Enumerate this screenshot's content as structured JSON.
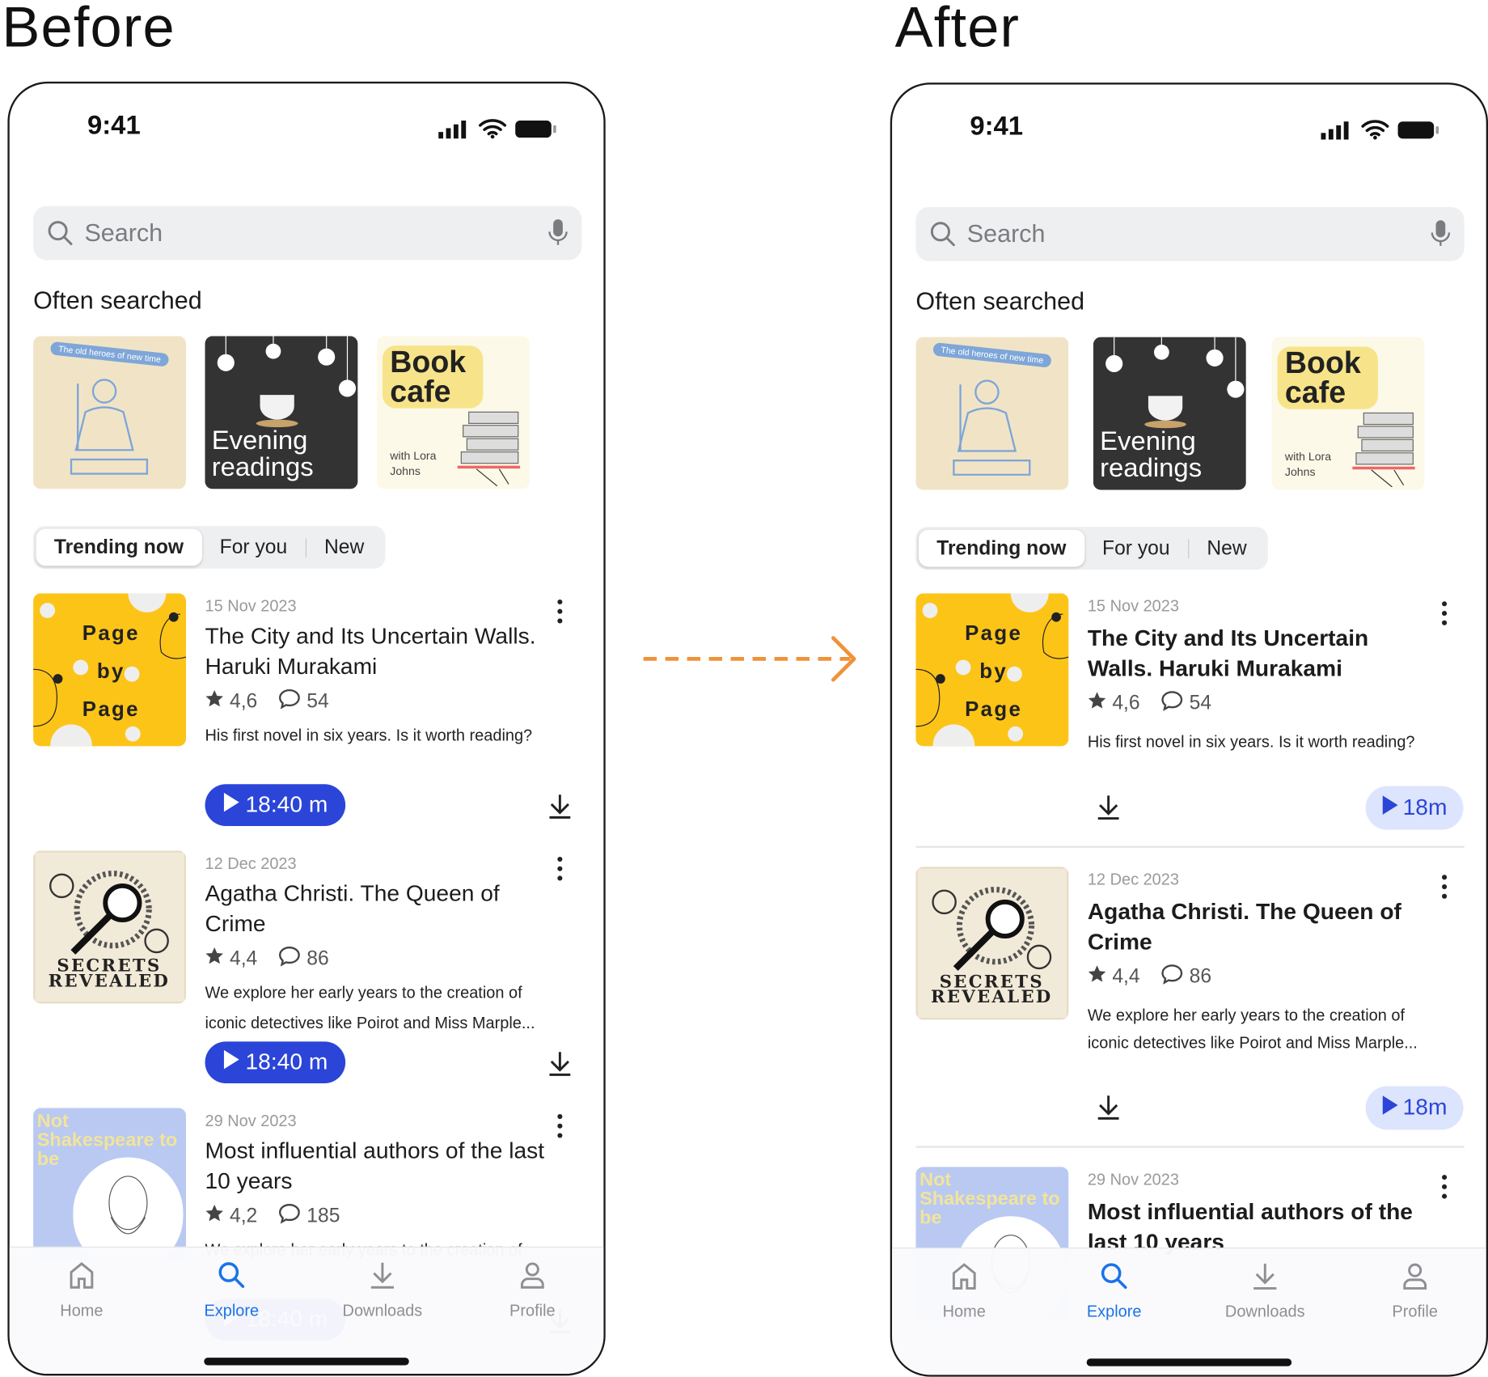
{
  "labels": {
    "before": "Before",
    "after": "After"
  },
  "colors": {
    "accent": "#2b45d8",
    "accent_soft": "#dde4fd",
    "arrow": "#f0923a",
    "nav_active": "#1a73e8"
  },
  "phones": {
    "before": {
      "status_time": "9:41",
      "search_placeholder": "Search",
      "section_title": "Often searched",
      "often_searched": [
        {
          "art_text": "The old heroes of new time"
        },
        {
          "art_text": "Evening readings"
        },
        {
          "art_text": "Book cafe",
          "art_subtext": "with Lora Johns"
        }
      ],
      "tabs": [
        {
          "label": "Trending now",
          "active": true
        },
        {
          "label": "For you"
        },
        {
          "label": "New"
        }
      ],
      "cards": [
        {
          "date": "15 Nov 2023",
          "title": "The City and Its Uncertain Walls. Haruki Murakami",
          "rating": "4,6",
          "comments": "54",
          "description": "His first novel in six years. Is it worth reading?",
          "duration": "18:40 m",
          "art_text": "Page by Page"
        },
        {
          "date": "12 Dec 2023",
          "title": "Agatha Christi. The Queen of Crime",
          "rating": "4,4",
          "comments": "86",
          "description": "We explore her early years to the creation of iconic detectives like Poirot and Miss Marple...",
          "duration": "18:40 m",
          "art_text": "SECRETS REVEALED"
        },
        {
          "date": "29 Nov 2023",
          "title": "Most influential authors of the last 10 years",
          "rating": "4,2",
          "comments": "185",
          "description": "We explore her early years to the creation of",
          "duration": "18:40 m",
          "art_text": "Not Shakespeare to be"
        }
      ],
      "nav": [
        {
          "label": "Home",
          "icon": "home-icon"
        },
        {
          "label": "Explore",
          "icon": "search-icon",
          "active": true
        },
        {
          "label": "Downloads",
          "icon": "download-icon"
        },
        {
          "label": "Profile",
          "icon": "profile-icon"
        }
      ]
    },
    "after": {
      "status_time": "9:41",
      "search_placeholder": "Search",
      "section_title": "Often searched",
      "often_searched": [
        {
          "art_text": "The old heroes of new time"
        },
        {
          "art_text": "Evening readings"
        },
        {
          "art_text": "Book cafe",
          "art_subtext": "with Lora Johns"
        }
      ],
      "tabs": [
        {
          "label": "Trending now",
          "active": true
        },
        {
          "label": "For you"
        },
        {
          "label": "New"
        }
      ],
      "cards": [
        {
          "date": "15 Nov 2023",
          "title": "The City and Its Uncertain Walls. Haruki Murakami",
          "rating": "4,6",
          "comments": "54",
          "description": "His first novel in six years. Is it worth reading?",
          "duration": "18m",
          "art_text": "Page by Page"
        },
        {
          "date": "12 Dec 2023",
          "title": "Agatha Christi. The Queen of Crime",
          "rating": "4,4",
          "comments": "86",
          "description": "We explore her early years to the creation of iconic detectives like Poirot and Miss Marple...",
          "duration": "18m",
          "art_text": "SECRETS REVEALED"
        },
        {
          "date": "29 Nov 2023",
          "title": "Most influential authors of the last 10 years",
          "rating": "",
          "comments": "",
          "description": "",
          "duration": "",
          "art_text": "Not Shakespeare to be"
        }
      ],
      "nav": [
        {
          "label": "Home",
          "icon": "home-icon"
        },
        {
          "label": "Explore",
          "icon": "search-icon",
          "active": true
        },
        {
          "label": "Downloads",
          "icon": "download-icon"
        },
        {
          "label": "Profile",
          "icon": "profile-icon"
        }
      ]
    }
  }
}
